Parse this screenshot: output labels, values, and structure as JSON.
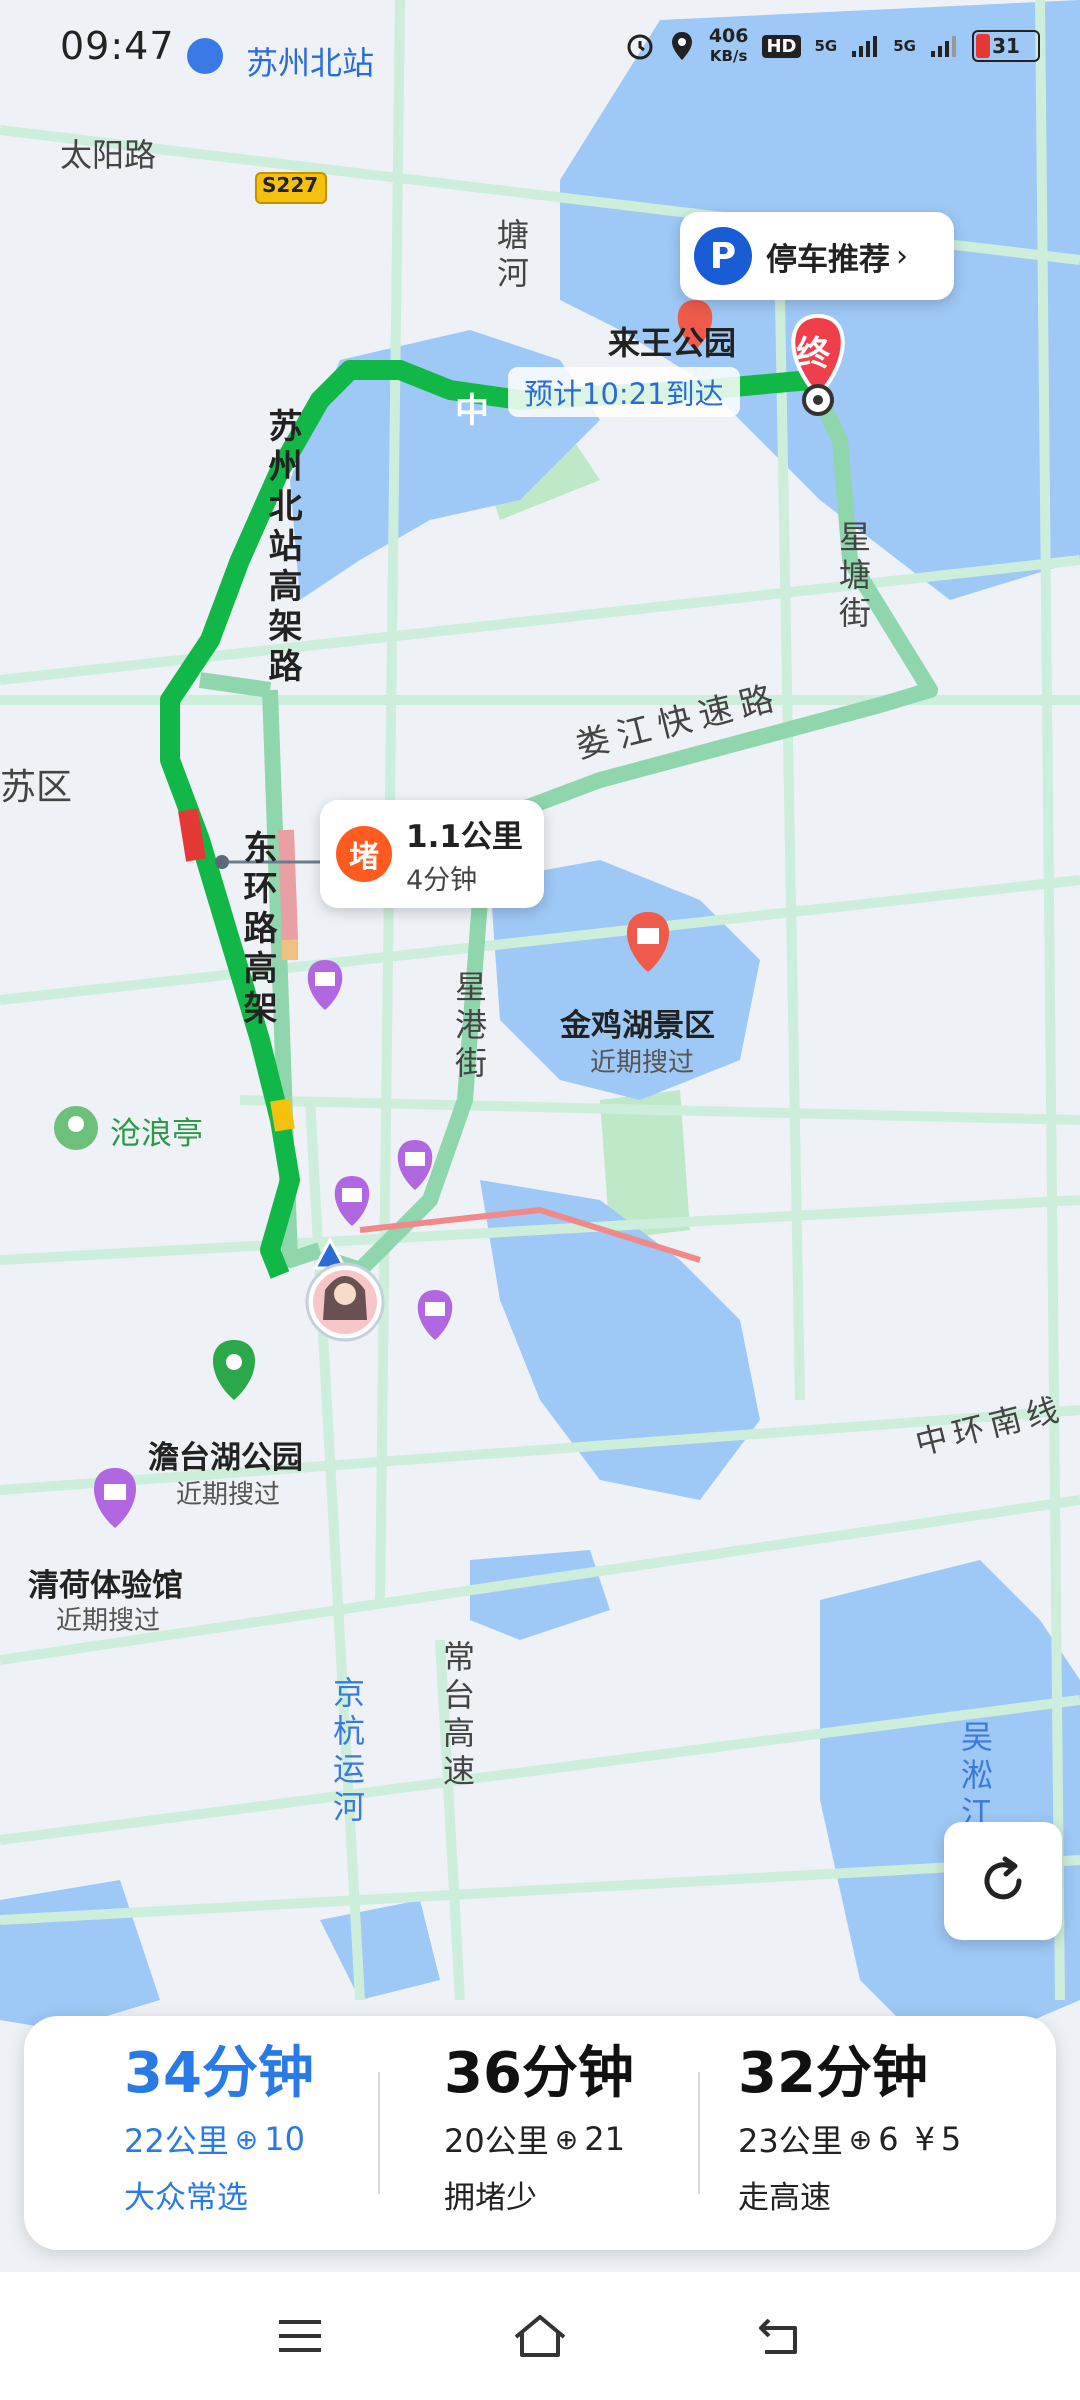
{
  "status_bar": {
    "time": "09:47",
    "net_speed_value": "406",
    "net_speed_unit": "KB/s",
    "hd": "HD",
    "sig1": "5G",
    "sig2": "5G",
    "battery": "31",
    "battery_color": "#e53935"
  },
  "map": {
    "labels": {
      "north_station": "苏州北站",
      "taiyang_road": "太阳路",
      "s227": "S227",
      "tang_river": "塘河",
      "laiwang_park": "来王公园",
      "zhong_road": "中",
      "north_station_elevated": "苏州北站高架路",
      "east_ring_elevated": "东环路高架",
      "xingtang_street": "星塘街",
      "loujiang_expressway": "娄江快速路",
      "su_district": "苏区",
      "xinggang_street": "星港街",
      "jinji_lake": "金鸡湖景区",
      "recent_search_1": "近期搜过",
      "canglang_pavilion": "沧浪亭",
      "dantai_park": "澹台湖公园",
      "recent_search_2": "近期搜过",
      "qinghe_hall": "清荷体验馆",
      "recent_search_3": "近期搜过",
      "middle_ring_south": "中环南线",
      "changtai_highway": "常台高速",
      "jinghang_canal": "京杭运河",
      "wusong_river": "吴淞江",
      "end_marker": "终"
    },
    "eta": "预计10:21到达",
    "colors": {
      "route_primary": "#12b847",
      "route_alt": "#8fd6ad",
      "water": "#9ec8f5",
      "park": "#bfe8c8",
      "road": "#d4f0df",
      "jam": "#ff5a1f",
      "end_marker": "#f03e4a",
      "selected": "#2a7ae6"
    }
  },
  "parking": {
    "icon": "P",
    "label": "停车推荐",
    "chevron": "›"
  },
  "traffic": {
    "badge": "堵",
    "distance": "1.1公里",
    "duration": "4分钟"
  },
  "routes": [
    {
      "duration": "34分钟",
      "distance": "22公里",
      "lights": "10",
      "toll": "",
      "tag": "大众常选",
      "selected": true
    },
    {
      "duration": "36分钟",
      "distance": "20公里",
      "lights": "21",
      "toll": "",
      "tag": "拥堵少",
      "selected": false
    },
    {
      "duration": "32分钟",
      "distance": "23公里",
      "lights": "6",
      "toll": "5",
      "tag": "走高速",
      "selected": false
    }
  ],
  "icons": {
    "refresh": "refresh-icon",
    "menu": "menu-icon",
    "home": "home-icon",
    "back": "back-icon",
    "traffic_light": "traffic-light-icon",
    "yen": "¥"
  }
}
